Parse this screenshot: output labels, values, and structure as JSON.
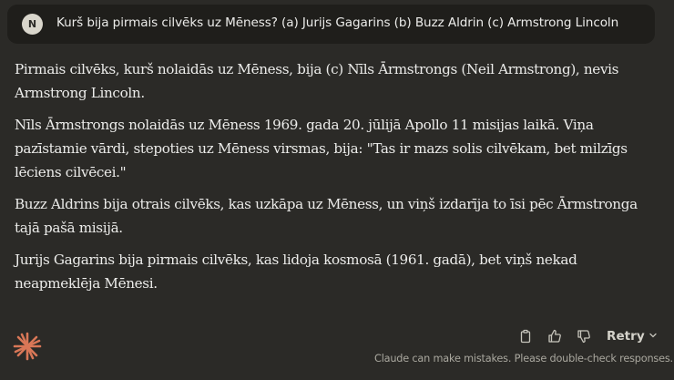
{
  "user_message": {
    "avatar_initial": "N",
    "text": "Kurš bija pirmais cilvēks uz Mēness? (a) Jurijs Gagarins (b) Buzz Aldrin (c) Armstrong Lincoln"
  },
  "response": {
    "paragraphs": [
      "Pirmais cilvēks, kurš nolaidās uz Mēness, bija (c) Nīls Ārmstrongs (Neil Armstrong), nevis Armstrong Lincoln.",
      "Nīls Ārmstrongs nolaidās uz Mēness 1969. gada 20. jūlijā Apollo 11 misijas laikā. Viņa pazīstamie vārdi, stepoties uz Mēness virsmas, bija: \"Tas ir mazs solis cilvēkam, bet milzīgs lēciens cilvēcei.\"",
      "Buzz Aldrins bija otrais cilvēks, kas uzkāpa uz Mēness, un viņš izdarīja to īsi pēc Ārmstronga tajā pašā misijā.",
      "Jurijs Gagarins bija pirmais cilvēks, kas lidoja kosmosā (1961. gadā), bet viņš nekad neapmeklēja Mēnesi."
    ]
  },
  "actions": {
    "copy_icon": "clipboard-icon",
    "like_icon": "thumbs-up-icon",
    "dislike_icon": "thumbs-down-icon",
    "retry_label": "Retry"
  },
  "disclaimer": "Claude can make mistakes. Please double-check responses.",
  "colors": {
    "background": "#2b2a27",
    "bubble": "#1f1e1b",
    "logo": "#d97757"
  }
}
